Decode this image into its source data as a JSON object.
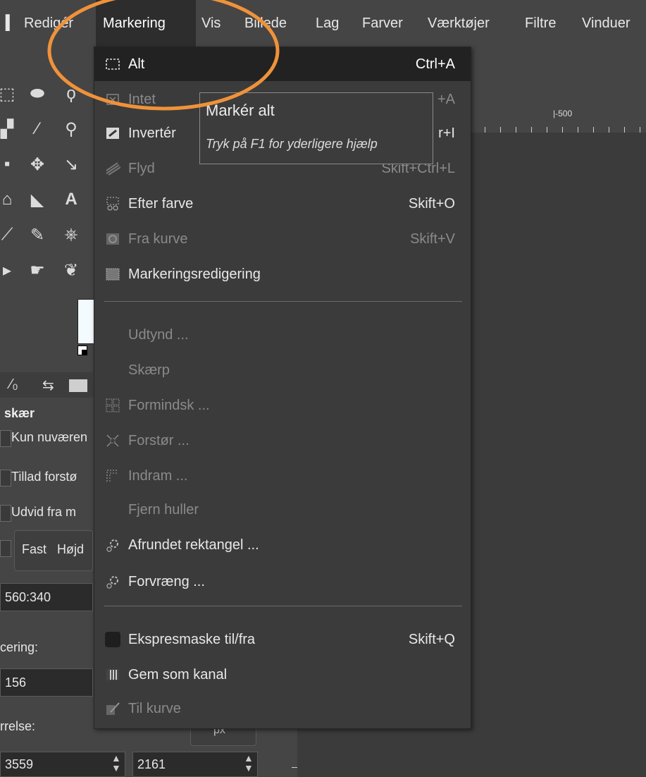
{
  "menubar": {
    "items": [
      {
        "label": "Redigér"
      },
      {
        "label": "Markering",
        "active": true
      },
      {
        "label": "Vis"
      },
      {
        "label": "Billede"
      },
      {
        "label": "Lag"
      },
      {
        "label": "Farver"
      },
      {
        "label": "Værktøjer"
      },
      {
        "label": "Filtre"
      },
      {
        "label": "Vinduer"
      }
    ]
  },
  "menu": {
    "items": [
      {
        "label": "Alt",
        "shortcut": "Ctrl+A",
        "icon": "select-all-icon",
        "state": "highlighted"
      },
      {
        "label": "Intet",
        "shortcut": "+A",
        "icon": "select-none-icon",
        "state": "disabled"
      },
      {
        "label": "Invertér",
        "shortcut": "r+I",
        "icon": "invert-selection-icon",
        "state": "enabled"
      },
      {
        "label": "Flyd",
        "shortcut": "Skift+Ctrl+L",
        "icon": "float-selection-icon",
        "state": "disabled"
      },
      {
        "label": "Efter farve",
        "shortcut": "Skift+O",
        "icon": "select-by-color-icon",
        "state": "enabled"
      },
      {
        "label": "Fra kurve",
        "shortcut": "Skift+V",
        "icon": "selection-from-path-icon",
        "state": "disabled"
      },
      {
        "label": "Markeringsredigering",
        "shortcut": "",
        "icon": "selection-editor-icon",
        "state": "enabled"
      },
      {
        "label": "Udtynd ...",
        "shortcut": "",
        "icon": "",
        "state": "disabled"
      },
      {
        "label": "Skærp",
        "shortcut": "",
        "icon": "",
        "state": "disabled"
      },
      {
        "label": "Formindsk ...",
        "shortcut": "",
        "icon": "shrink-icon",
        "state": "disabled"
      },
      {
        "label": "Forstør ...",
        "shortcut": "",
        "icon": "grow-icon",
        "state": "disabled"
      },
      {
        "label": "Indram ...",
        "shortcut": "",
        "icon": "border-icon",
        "state": "disabled"
      },
      {
        "label": "Fjern huller",
        "shortcut": "",
        "icon": "",
        "state": "disabled"
      },
      {
        "label": "Afrundet rektangel ...",
        "shortcut": "",
        "icon": "script-gear-icon",
        "state": "enabled"
      },
      {
        "label": "Forvræng ...",
        "shortcut": "",
        "icon": "script-gear-icon",
        "state": "enabled"
      },
      {
        "label": "Ekspresmaske til/fra",
        "shortcut": "Skift+Q",
        "icon": "quick-mask-icon",
        "state": "enabled"
      },
      {
        "label": "Gem som kanal",
        "shortcut": "",
        "icon": "save-channel-icon",
        "state": "enabled"
      },
      {
        "label": "Til kurve",
        "shortcut": "",
        "icon": "to-path-icon",
        "state": "disabled"
      }
    ]
  },
  "tooltip": {
    "title": "Markér alt",
    "hint": "Tryk på F1 for yderligere hjælp"
  },
  "ruler": {
    "label": "|-500"
  },
  "tool_options": {
    "section": "skær",
    "opt1": "Kun nuværen",
    "opt2": "Tillad forstø",
    "opt3": "Udvid fra m",
    "fixed_label": "Fast",
    "fixed_value": "Højd",
    "ratio": "560:340",
    "position_label": "cering:",
    "position_value": "156",
    "size_label": "rrelse:",
    "unit": "px",
    "width": "3559",
    "height": "2161"
  },
  "colors": {
    "accent_ellipse": "#f0923a",
    "menu_bg": "#3b3b3b",
    "highlight_bg": "#222222"
  }
}
